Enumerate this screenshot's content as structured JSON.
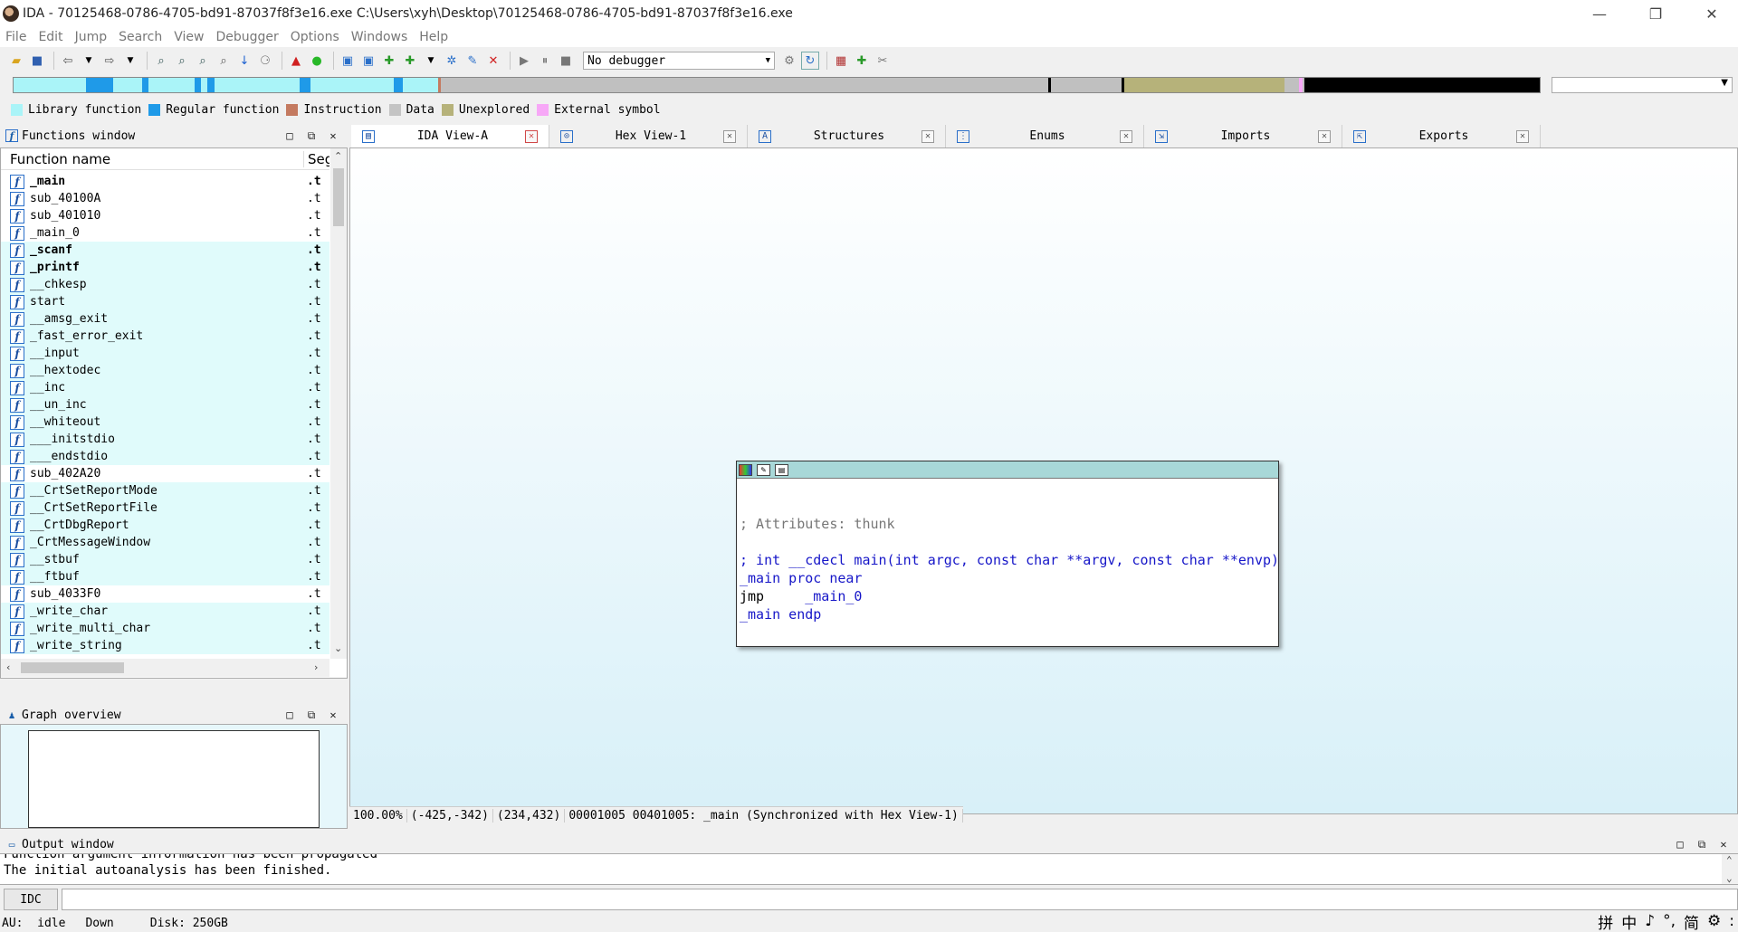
{
  "window": {
    "title": "IDA - 70125468-0786-4705-bd91-87037f8f3e16.exe C:\\Users\\xyh\\Desktop\\70125468-0786-4705-bd91-87037f8f3e16.exe",
    "minimize": "—",
    "restore": "❐",
    "close": "✕"
  },
  "menu": [
    "File",
    "Edit",
    "Jump",
    "Search",
    "View",
    "Debugger",
    "Options",
    "Windows",
    "Help"
  ],
  "toolbar": {
    "debugger_select": "No debugger"
  },
  "legend": [
    {
      "label": "Library function",
      "color": "#aaf4f8"
    },
    {
      "label": "Regular function",
      "color": "#1f9ae8"
    },
    {
      "label": "Instruction",
      "color": "#c47a60"
    },
    {
      "label": "Data",
      "color": "#c4c4c4"
    },
    {
      "label": "Unexplored",
      "color": "#b6b27a"
    },
    {
      "label": "External symbol",
      "color": "#f7a8f7"
    }
  ],
  "functions_window": {
    "title": "Functions window",
    "col_name": "Function name",
    "col_segment": "Segment",
    "rows": [
      {
        "name": "_main",
        "seg": ".t",
        "bold": true,
        "lib": false
      },
      {
        "name": "sub_40100A",
        "seg": ".t",
        "bold": false,
        "lib": false
      },
      {
        "name": "sub_401010",
        "seg": ".t",
        "bold": false,
        "lib": false
      },
      {
        "name": "_main_0",
        "seg": ".t",
        "bold": false,
        "lib": false
      },
      {
        "name": "_scanf",
        "seg": ".t",
        "bold": true,
        "lib": true
      },
      {
        "name": "_printf",
        "seg": ".t",
        "bold": true,
        "lib": true
      },
      {
        "name": "__chkesp",
        "seg": ".t",
        "bold": false,
        "lib": true
      },
      {
        "name": "start",
        "seg": ".t",
        "bold": false,
        "lib": true
      },
      {
        "name": "__amsg_exit",
        "seg": ".t",
        "bold": false,
        "lib": true
      },
      {
        "name": "_fast_error_exit",
        "seg": ".t",
        "bold": false,
        "lib": true
      },
      {
        "name": "__input",
        "seg": ".t",
        "bold": false,
        "lib": true
      },
      {
        "name": "__hextodec",
        "seg": ".t",
        "bold": false,
        "lib": true
      },
      {
        "name": "__inc",
        "seg": ".t",
        "bold": false,
        "lib": true
      },
      {
        "name": "__un_inc",
        "seg": ".t",
        "bold": false,
        "lib": true
      },
      {
        "name": "__whiteout",
        "seg": ".t",
        "bold": false,
        "lib": true
      },
      {
        "name": "___initstdio",
        "seg": ".t",
        "bold": false,
        "lib": true
      },
      {
        "name": "___endstdio",
        "seg": ".t",
        "bold": false,
        "lib": true
      },
      {
        "name": "sub_402A20",
        "seg": ".t",
        "bold": false,
        "lib": false
      },
      {
        "name": "__CrtSetReportMode",
        "seg": ".t",
        "bold": false,
        "lib": true
      },
      {
        "name": "__CrtSetReportFile",
        "seg": ".t",
        "bold": false,
        "lib": true
      },
      {
        "name": "__CrtDbgReport",
        "seg": ".t",
        "bold": false,
        "lib": true
      },
      {
        "name": "_CrtMessageWindow",
        "seg": ".t",
        "bold": false,
        "lib": true
      },
      {
        "name": "__stbuf",
        "seg": ".t",
        "bold": false,
        "lib": true
      },
      {
        "name": "__ftbuf",
        "seg": ".t",
        "bold": false,
        "lib": true
      },
      {
        "name": "sub_4033F0",
        "seg": ".t",
        "bold": false,
        "lib": false
      },
      {
        "name": "_write_char",
        "seg": ".t",
        "bold": false,
        "lib": true
      },
      {
        "name": "_write_multi_char",
        "seg": ".t",
        "bold": false,
        "lib": true
      },
      {
        "name": "_write_string",
        "seg": ".t",
        "bold": false,
        "lib": true
      }
    ]
  },
  "graph_overview": {
    "title": "Graph overview"
  },
  "tabs": [
    {
      "label": "IDA View-A",
      "icon": "ida-view-icon",
      "active": true
    },
    {
      "label": "Hex View-1",
      "icon": "hex-view-icon",
      "active": false
    },
    {
      "label": "Structures",
      "icon": "structures-icon",
      "active": false
    },
    {
      "label": "Enums",
      "icon": "enums-icon",
      "active": false
    },
    {
      "label": "Imports",
      "icon": "imports-icon",
      "active": false
    },
    {
      "label": "Exports",
      "icon": "exports-icon",
      "active": false
    }
  ],
  "graph_node": {
    "comment": "; Attributes: thunk",
    "signature": "; int __cdecl main(int argc, const char **argv, const char **envp)",
    "proc": "_main proc near",
    "jmp_mnemonic": "jmp     ",
    "jmp_target": "_main_0",
    "endp": "_main endp"
  },
  "graph_status": {
    "zoom": "100.00%",
    "coords1": "(-425,-342)",
    "coords2": "(234,432)",
    "location": "00001005 00401005: _main (Synchronized with Hex View-1)"
  },
  "output_window": {
    "title": "Output window",
    "lines": [
      "Function argument information has been propagated",
      "The initial autoanalysis has been finished."
    ]
  },
  "idc": {
    "button": "IDC"
  },
  "statusbar": {
    "au": "AU:  idle",
    "dir": "Down",
    "disk": "Disk: 250GB"
  },
  "ime": [
    "拼",
    "中",
    "♪",
    "°,",
    "简",
    "⚙",
    ":"
  ]
}
